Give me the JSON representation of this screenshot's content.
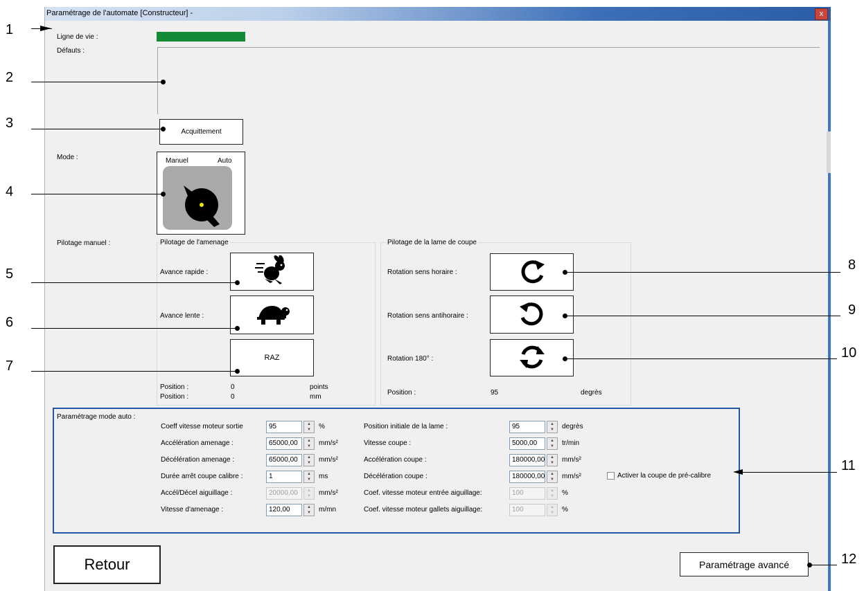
{
  "window": {
    "title": "Paramétrage de l'automate [Constructeur] -",
    "close_label": "x"
  },
  "callouts": [
    "1",
    "2",
    "3",
    "4",
    "5",
    "6",
    "7",
    "8",
    "9",
    "10",
    "11",
    "12"
  ],
  "life_line": {
    "label": "Ligne de vie :",
    "color": "#138a36"
  },
  "faults": {
    "label": "Défauts :"
  },
  "ack_button": {
    "label": "Acquittement"
  },
  "mode": {
    "label": "Mode :",
    "manual_label": "Manuel",
    "auto_label": "Auto",
    "icon": "rotary-selector-icon"
  },
  "manual_control": {
    "label": "Pilotage manuel :",
    "feed": {
      "title": "Pilotage de l'amenage",
      "fast_label": "Avance rapide :",
      "fast_icon": "rabbit-icon",
      "slow_label": "Avance lente :",
      "slow_icon": "turtle-icon",
      "reset_label": "RAZ",
      "pos1_label": "Position :",
      "pos1_value": "0",
      "pos1_unit": "points",
      "pos2_label": "Position :",
      "pos2_value": "0",
      "pos2_unit": "mm"
    },
    "blade": {
      "title": "Pilotage de la lame de coupe",
      "cw_label": "Rotation sens horaire :",
      "cw_icon": "rotate-clockwise-icon",
      "ccw_label": "Rotation sens antihoraire :",
      "ccw_icon": "rotate-counterclockwise-icon",
      "r180_label": "Rotation 180° :",
      "r180_icon": "rotate-180-icon",
      "pos_label": "Position :",
      "pos_value": "95",
      "pos_unit": "degrès"
    }
  },
  "auto_params": {
    "label": "Paramétrage mode auto :",
    "left": [
      {
        "label": "Coeff vitesse moteur sortie",
        "value": "95",
        "unit": "%",
        "disabled": false
      },
      {
        "label": "Accélération amenage :",
        "value": "65000,00",
        "unit": "mm/s²",
        "disabled": false
      },
      {
        "label": "Décélération amenage :",
        "value": "65000,00",
        "unit": "mm/s²",
        "disabled": false
      },
      {
        "label": "Durée arrêt coupe calibre :",
        "value": "1",
        "unit": "ms",
        "disabled": false
      },
      {
        "label": "Accél/Décel aiguillage :",
        "value": "20000,00",
        "unit": "mm/s²",
        "disabled": true
      },
      {
        "label": "Vitesse d'amenage :",
        "value": "120,00",
        "unit": "m/mn",
        "disabled": false
      }
    ],
    "right": [
      {
        "label": "Position initiale de la lame :",
        "value": "95",
        "unit": "degrès",
        "disabled": false
      },
      {
        "label": "Vitesse coupe :",
        "value": "5000,00",
        "unit": "tr/min",
        "disabled": false
      },
      {
        "label": "Accélération coupe :",
        "value": "180000,00",
        "unit": "mm/s²",
        "disabled": false
      },
      {
        "label": "Décélération coupe :",
        "value": "180000,00",
        "unit": "mm/s²",
        "disabled": false
      },
      {
        "label": "Coef. vitesse moteur entrée aiguillage:",
        "value": "100",
        "unit": "%",
        "disabled": true
      },
      {
        "label": "Coef. vitesse moteur gallets aiguillage:",
        "value": "100",
        "unit": "%",
        "disabled": true
      }
    ],
    "precut_checkbox": {
      "label": "Activer la coupe de pré-calibre",
      "checked": false
    }
  },
  "back_button": {
    "label": "Retour"
  },
  "advanced_button": {
    "label": "Paramétrage avancé"
  }
}
